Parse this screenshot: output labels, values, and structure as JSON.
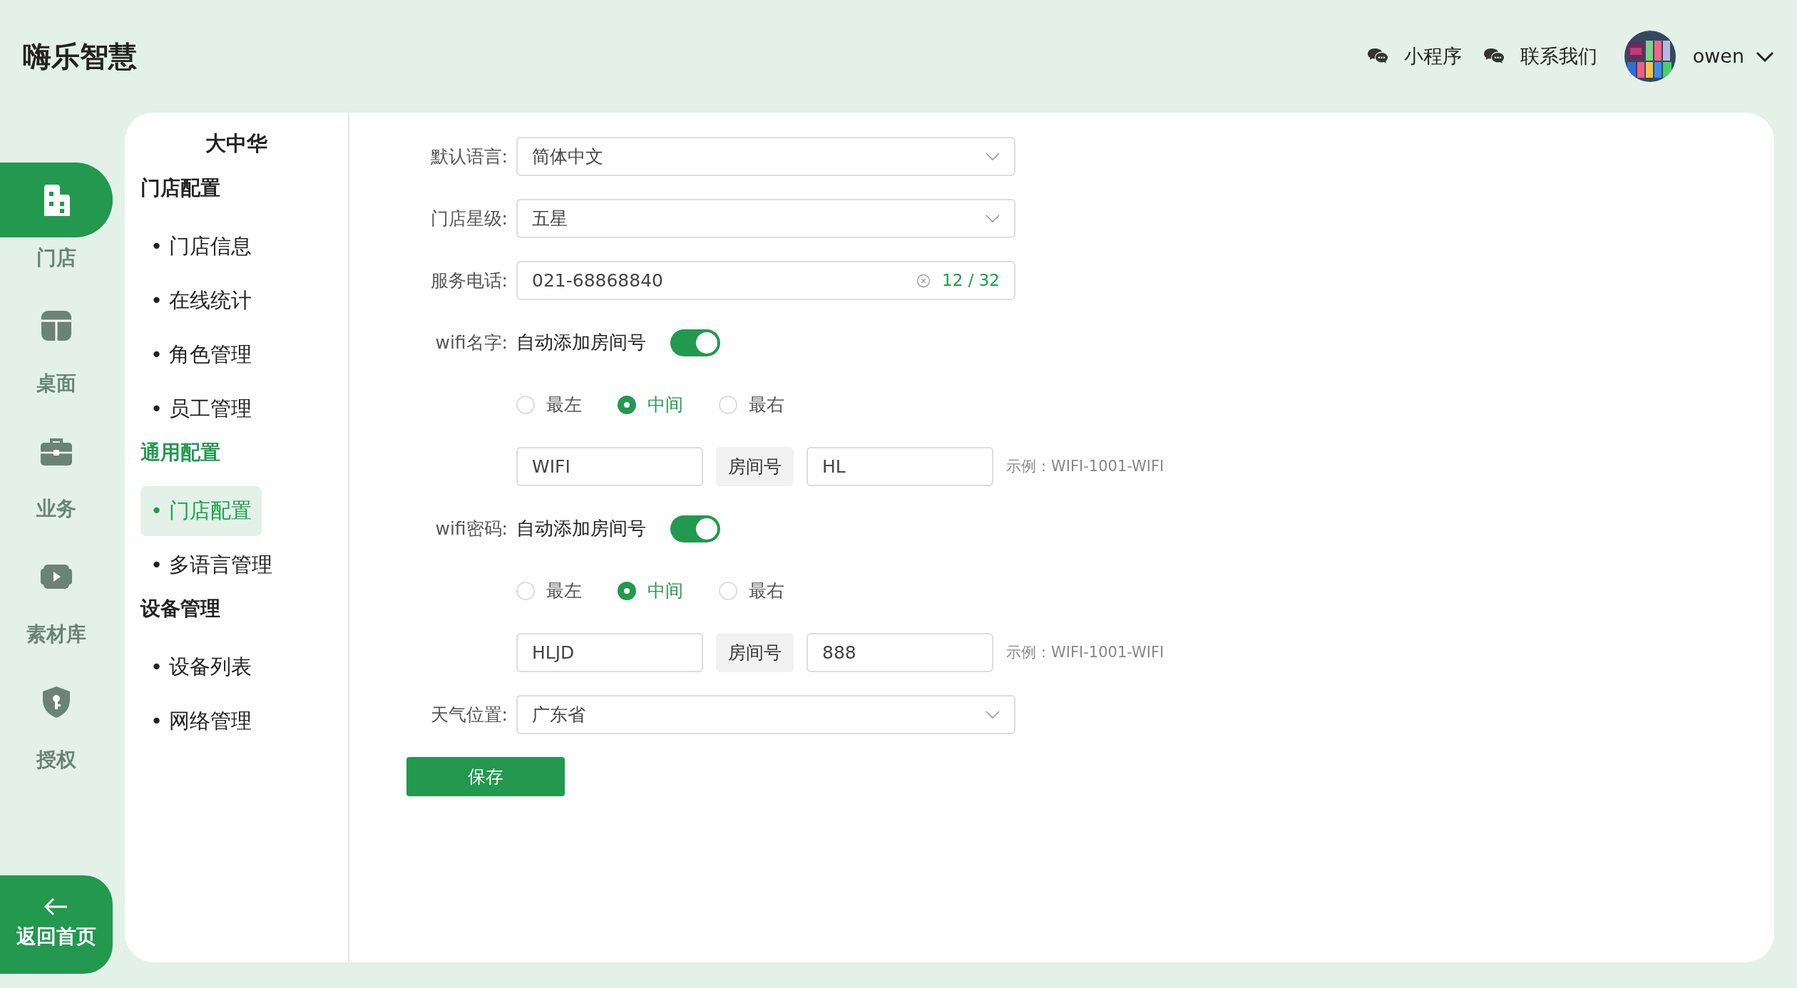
{
  "app": {
    "title": "嗨乐智慧"
  },
  "header_links": [
    {
      "label": "小程序"
    },
    {
      "label": "联系我们"
    }
  ],
  "user": {
    "name": "owen"
  },
  "rail": [
    {
      "label": "门店",
      "selected": true
    },
    {
      "label": "桌面",
      "selected": false
    },
    {
      "label": "业务",
      "selected": false
    },
    {
      "label": "素材库",
      "selected": false
    },
    {
      "label": "授权",
      "selected": false
    }
  ],
  "back": {
    "label": "返回首页"
  },
  "sidebar": {
    "title": "大中华",
    "groups": [
      {
        "title": "门店配置",
        "active": false,
        "items": [
          {
            "label": "• 门店信息",
            "selected": false
          },
          {
            "label": "• 在线统计",
            "selected": false
          },
          {
            "label": "• 角色管理",
            "selected": false
          },
          {
            "label": "• 员工管理",
            "selected": false
          }
        ]
      },
      {
        "title": "通用配置",
        "active": true,
        "items": [
          {
            "label": "• 门店配置",
            "selected": true
          },
          {
            "label": "• 多语言管理",
            "selected": false
          }
        ]
      },
      {
        "title": "设备管理",
        "active": false,
        "items": [
          {
            "label": "• 设备列表",
            "selected": false
          },
          {
            "label": "• 网络管理",
            "selected": false
          }
        ]
      }
    ]
  },
  "form": {
    "rows": [
      {
        "kind": "select",
        "label": "默认语言:",
        "value": "简体中文"
      },
      {
        "kind": "select",
        "label": "门店星级:",
        "value": "五星"
      },
      {
        "kind": "text",
        "label": "服务电话:",
        "value": "021-68868840",
        "counter": "12 / 32"
      },
      {
        "kind": "toggle",
        "label": "wifi名字:",
        "text": "自动添加房间号",
        "on": true
      },
      {
        "kind": "radio",
        "options": [
          {
            "label": "最左",
            "selected": false
          },
          {
            "label": "中间",
            "selected": true
          },
          {
            "label": "最右",
            "selected": false
          }
        ]
      },
      {
        "kind": "compose",
        "prefix": "WIFI",
        "middle": "房间号",
        "suffix": "HL",
        "hint": "示例：WIFI-1001-WIFI"
      },
      {
        "kind": "toggle",
        "label": "wifi密码:",
        "text": "自动添加房间号",
        "on": true
      },
      {
        "kind": "radio",
        "options": [
          {
            "label": "最左",
            "selected": false
          },
          {
            "label": "中间",
            "selected": true
          },
          {
            "label": "最右",
            "selected": false
          }
        ]
      },
      {
        "kind": "compose",
        "prefix": "HLJD",
        "middle": "房间号",
        "suffix": "888",
        "hint": "示例：WIFI-1001-WIFI"
      },
      {
        "kind": "select",
        "label": "天气位置:",
        "value": "广东省"
      }
    ],
    "save": "保存"
  }
}
